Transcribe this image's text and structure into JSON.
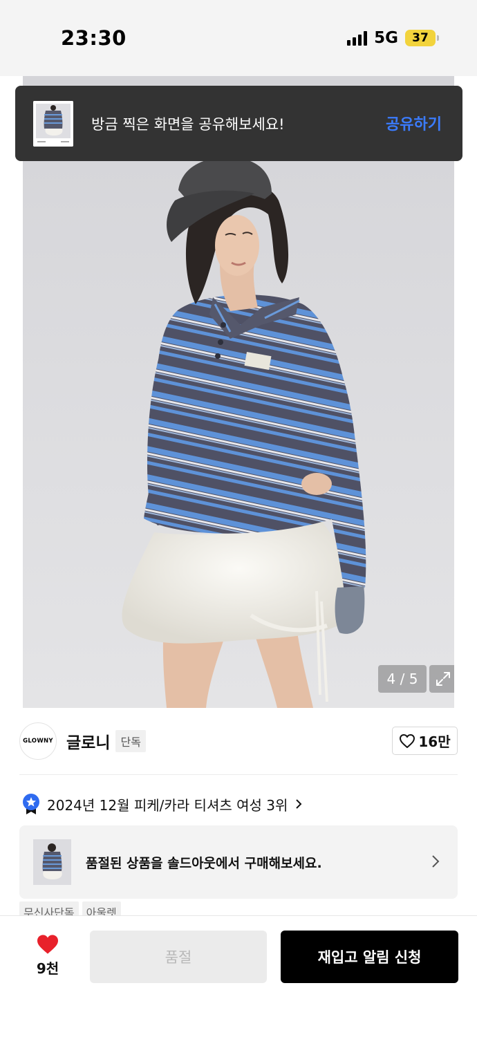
{
  "status_bar": {
    "time": "23:30",
    "network": "5G",
    "battery": "37"
  },
  "share_toast": {
    "message": "방금 찍은 화면을 공유해보세요!",
    "action_label": "공유하기"
  },
  "gallery": {
    "counter": "4 / 5",
    "current_index": 4,
    "total": 5
  },
  "brand": {
    "logo_text": "GLOWNY",
    "name": "글로니",
    "badge": "단독",
    "like_count": "16만"
  },
  "ranking": {
    "text": "2024년 12월 피케/카라 티셔츠 여성 3위"
  },
  "promo": {
    "text": "품절된 상품을 솔드아웃에서 구매해보세요."
  },
  "tags": [
    "무신사단독",
    "아울렛"
  ],
  "bottom_bar": {
    "wish_count": "9천",
    "soldout_label": "품절",
    "restock_label": "재입고 알림 신청"
  },
  "colors": {
    "accent_blue": "#3b7cff",
    "heart_red": "#e8212b",
    "toast_bg": "#333333",
    "primary_button": "#000000",
    "stripe_navy": "#4e5063",
    "stripe_blue": "#5b8fd6"
  },
  "icons": {
    "wish": "heart-filled-icon",
    "like": "heart-outline-icon",
    "ranking": "ranking-medal-icon",
    "expand": "expand-icon",
    "chevron": "chevron-right-icon"
  }
}
